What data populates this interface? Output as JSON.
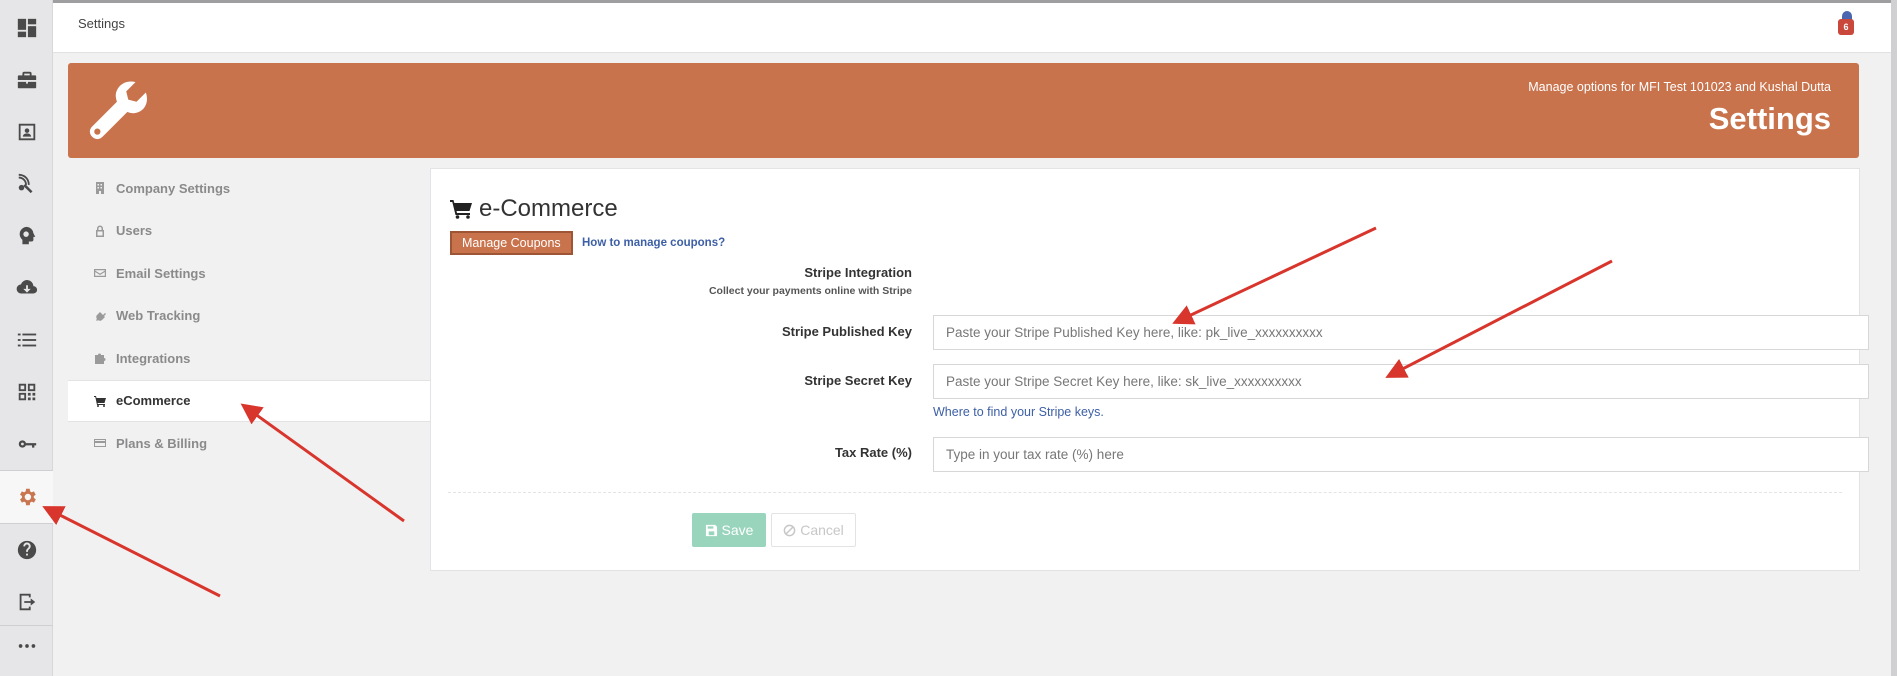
{
  "topbar": {
    "title": "Settings",
    "notification_count": "6"
  },
  "rail": {
    "items": [
      {
        "name": "dashboard-icon"
      },
      {
        "name": "briefcase-icon"
      },
      {
        "name": "contact-card-icon"
      },
      {
        "name": "tracking-icon"
      },
      {
        "name": "brain-icon"
      },
      {
        "name": "cloud-download-icon"
      },
      {
        "name": "list-icon"
      },
      {
        "name": "qr-code-icon"
      },
      {
        "name": "key-icon"
      },
      {
        "name": "gear-icon",
        "active": true
      },
      {
        "name": "help-icon"
      },
      {
        "name": "logout-icon"
      },
      {
        "name": "more-icon"
      }
    ]
  },
  "banner": {
    "subtitle": "Manage options for MFI Test 101023 and Kushal Dutta",
    "title": "Settings"
  },
  "subnav": {
    "items": [
      {
        "label": "Company Settings",
        "icon": "building-icon"
      },
      {
        "label": "Users",
        "icon": "lock-icon"
      },
      {
        "label": "Email Settings",
        "icon": "envelope-icon"
      },
      {
        "label": "Web Tracking",
        "icon": "plug-icon"
      },
      {
        "label": "Integrations",
        "icon": "puzzle-icon"
      },
      {
        "label": "eCommerce",
        "icon": "cart-icon",
        "active": true
      },
      {
        "label": "Plans & Billing",
        "icon": "credit-card-icon"
      }
    ]
  },
  "main": {
    "title": "e-Commerce",
    "manage_coupons": "Manage Coupons",
    "how_to_link": "How to manage coupons?",
    "stripe_heading": "Stripe Integration",
    "stripe_subheading": "Collect your payments online with Stripe",
    "published_key_label": "Stripe Published Key",
    "published_key_placeholder": "Paste your Stripe Published Key here, like: pk_live_xxxxxxxxxx",
    "secret_key_label": "Stripe Secret Key",
    "secret_key_placeholder": "Paste your Stripe Secret Key here, like: sk_live_xxxxxxxxxx",
    "find_keys_link": "Where to find your Stripe keys.",
    "tax_rate_label": "Tax Rate (%)",
    "tax_rate_placeholder": "Type in your tax rate (%) here",
    "save_label": "Save",
    "cancel_label": "Cancel"
  },
  "colors": {
    "accent": "#c9734d",
    "annotation_arrow": "#d8352c",
    "save_disabled": "#99d4bd",
    "link": "#3d5fa5"
  }
}
